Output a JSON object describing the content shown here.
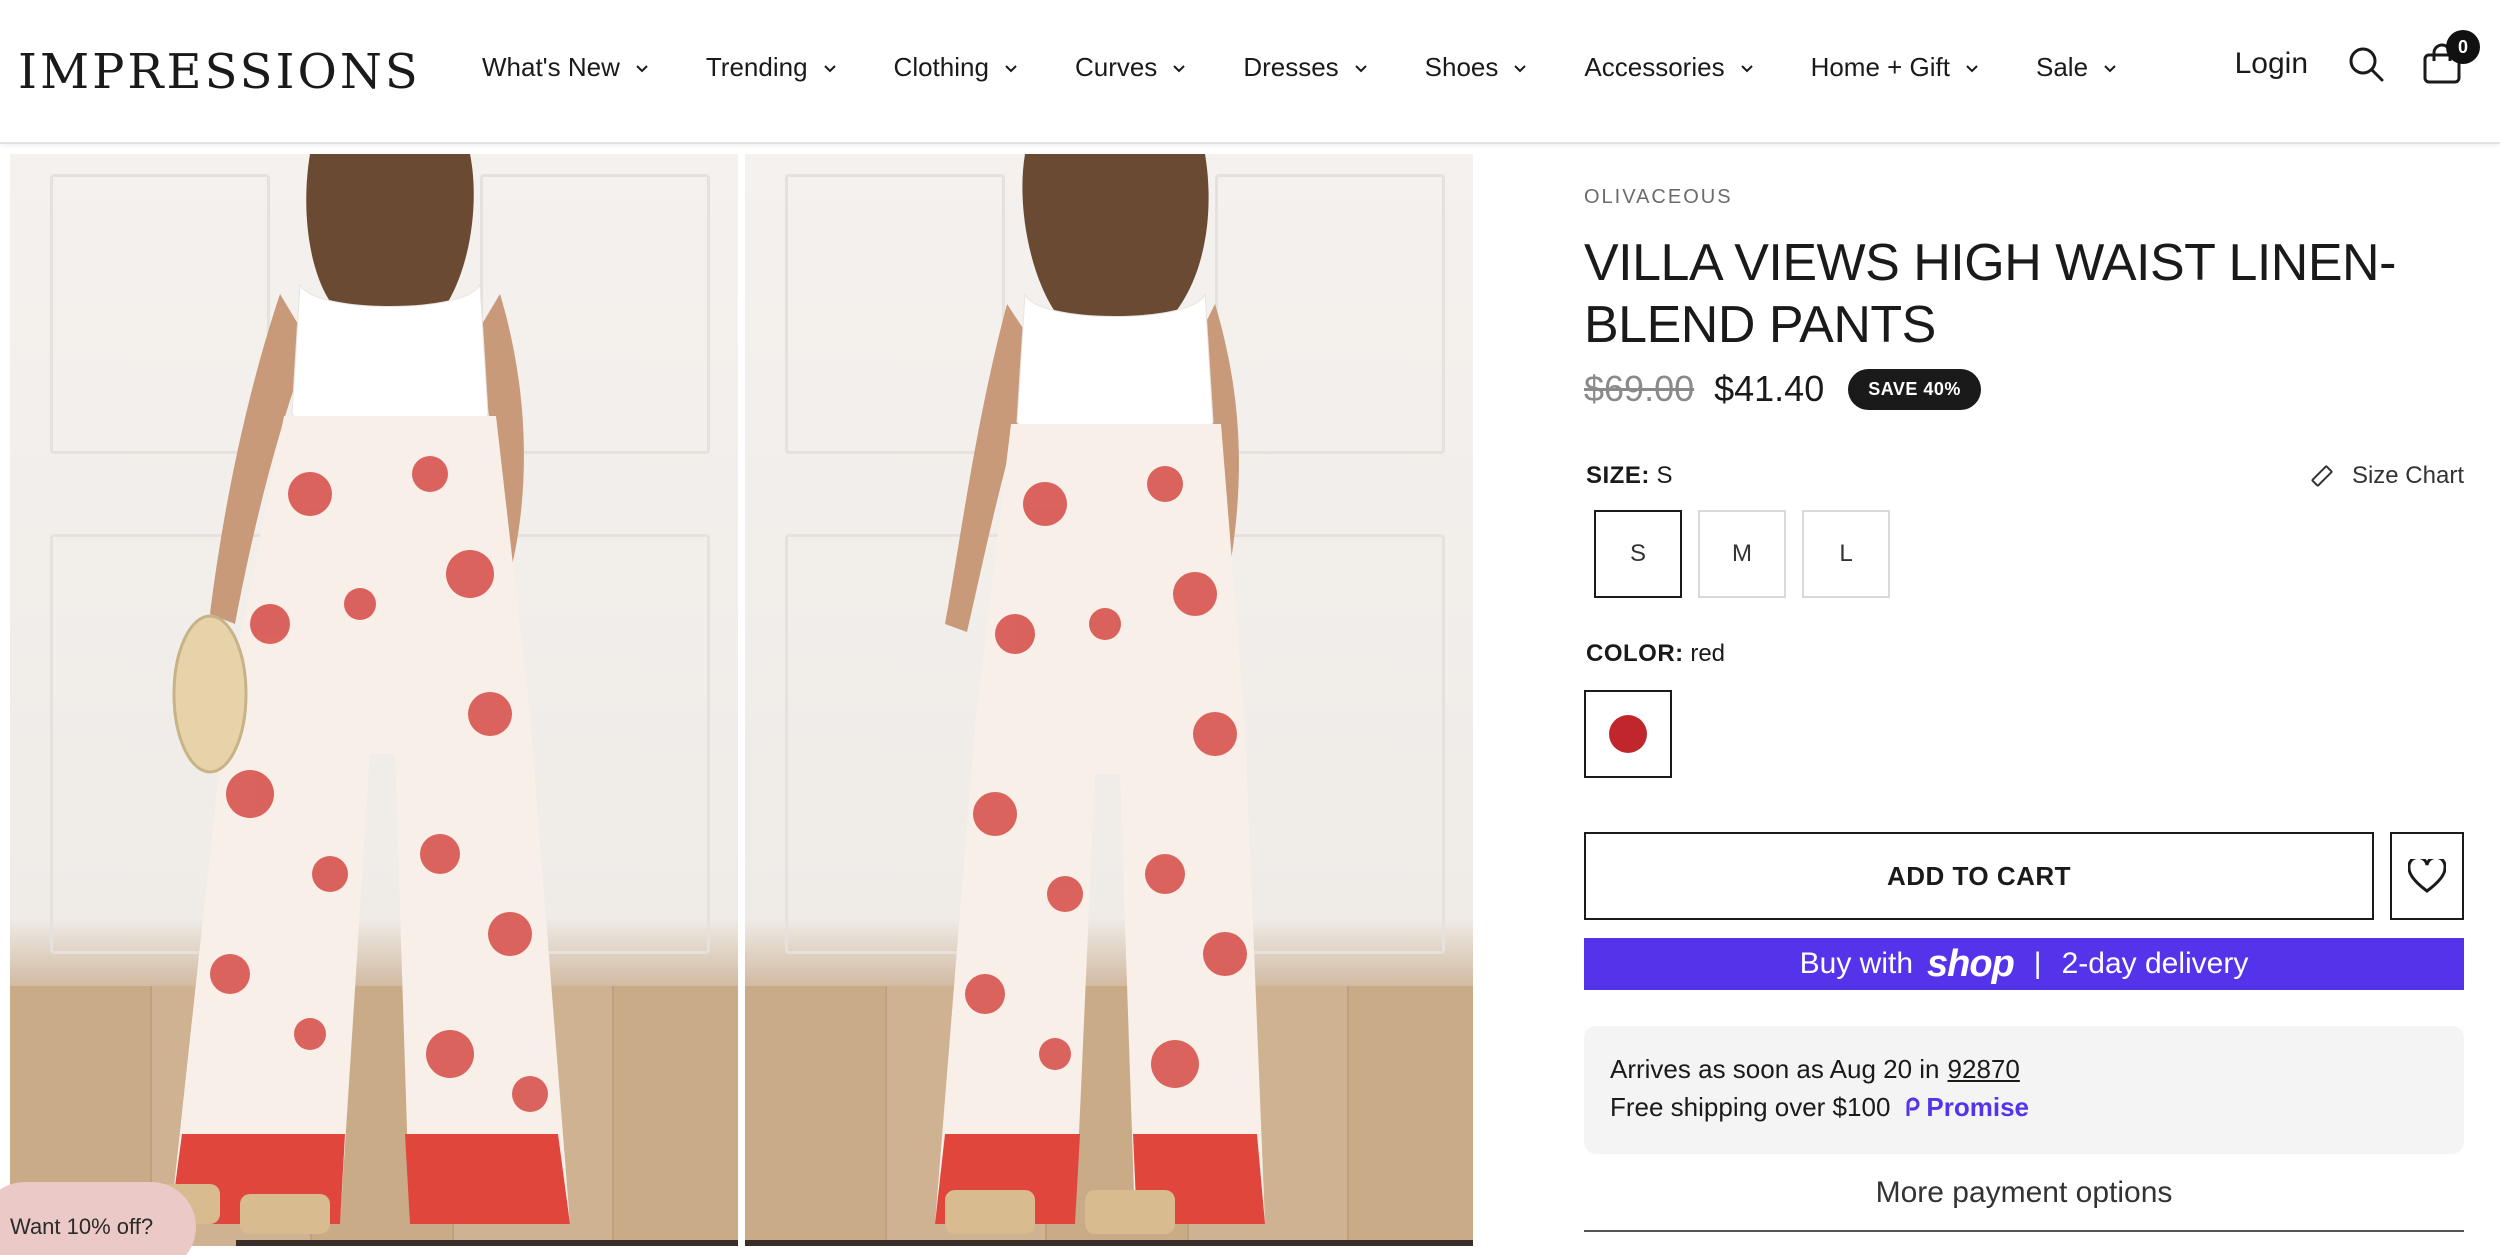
{
  "header": {
    "logo": "IMPRESSIONS",
    "nav": [
      {
        "label": "What's New"
      },
      {
        "label": "Trending"
      },
      {
        "label": "Clothing"
      },
      {
        "label": "Curves"
      },
      {
        "label": "Dresses"
      },
      {
        "label": "Shoes"
      },
      {
        "label": "Accessories"
      },
      {
        "label": "Home + Gift"
      },
      {
        "label": "Sale"
      }
    ],
    "login": "Login",
    "cart_count": "0"
  },
  "gallery": {
    "images": [
      "product-photo-front",
      "product-photo-front-alt"
    ]
  },
  "promo": {
    "label": "Want 10% off?"
  },
  "product": {
    "brand": "OLIVACEOUS",
    "title": "VILLA VIEWS HIGH WAIST LINEN-BLEND PANTS",
    "old_price": "$69.00",
    "price": "$41.40",
    "save_badge": "SAVE 40%",
    "size_label": "SIZE:",
    "size_value": "S",
    "size_chart": "Size Chart",
    "sizes": [
      "S",
      "M",
      "L"
    ],
    "color_label": "COLOR:",
    "color_value": "red",
    "color_swatch": "#c0272d",
    "add_to_cart": "ADD TO CART",
    "shop_pay": {
      "prefix": "Buy with",
      "brand": "shop",
      "sep": "|",
      "suffix": "2-day delivery",
      "color": "#5433eb"
    },
    "shipping": {
      "arrives_prefix": "Arrives as soon as Aug 20 in",
      "zip": "92870",
      "free_shipping": "Free shipping over $100",
      "promise": "Promise"
    },
    "more_payment": "More payment options"
  }
}
